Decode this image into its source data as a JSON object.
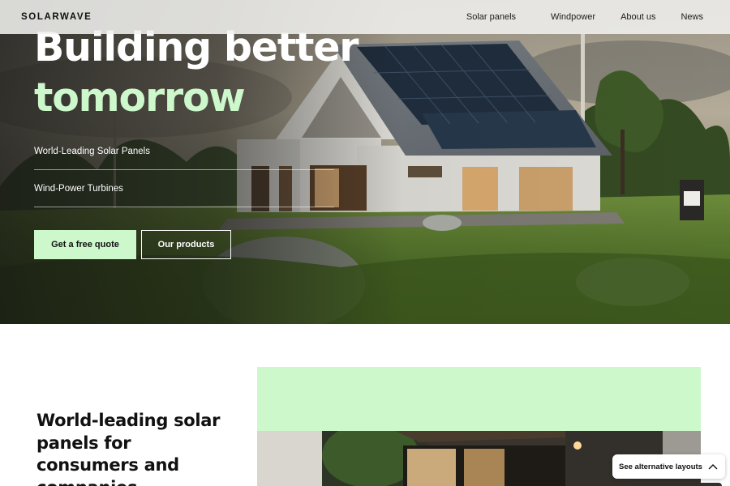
{
  "nav": {
    "logo": "SOLARWAVE",
    "links": [
      "Solar panels",
      "Windpower",
      "About us",
      "News"
    ]
  },
  "hero": {
    "headline_line1": "Building better",
    "headline_line2": "tomorrow",
    "features": [
      "World-Leading Solar Panels",
      "Wind-Power Turbines"
    ],
    "primary_cta": "Get a free quote",
    "secondary_cta": "Our products",
    "accent_color": "#cdf8cc"
  },
  "section": {
    "title": "World-leading solar panels for consumers and companies"
  },
  "floating": {
    "layouts_label": "See alternative layouts",
    "chevron_icon": "chevron-up-icon"
  }
}
